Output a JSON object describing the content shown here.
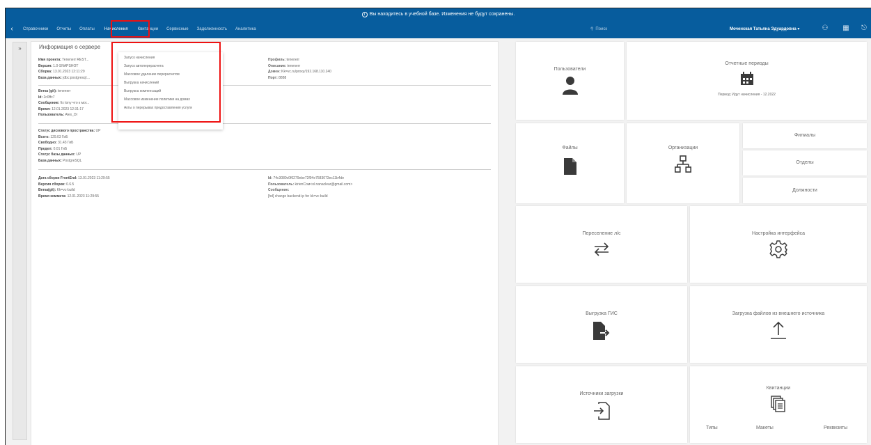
{
  "banner": {
    "text": "Вы находитесь в учебной базе. Изменения не будут сохранены."
  },
  "nav": {
    "items": [
      "Справочники",
      "Отчеты",
      "Оплаты",
      "Начисления",
      "Квитанции",
      "Сервисные",
      "Задолженность",
      "Аналитика"
    ],
    "search_placeholder": "Поиск",
    "user": "Моченская Татьяна Эдуардовна"
  },
  "panel": {
    "title": "Информация о сервере",
    "server": [
      {
        "k": "Имя проекта:",
        "v": "Tenenerr REST..."
      },
      {
        "k": "Версия:",
        "v": "1.0-SNAPSHOT"
      },
      {
        "k": "Сборка:",
        "v": "13.01.2023 12:11:29"
      },
      {
        "k": "База данных:",
        "v": "jdbc:postgresql:..."
      }
    ],
    "profile": [
      {
        "k": "Профиль:",
        "v": "tenenerr"
      },
      {
        "k": "Описание:",
        "v": "tenenerr"
      },
      {
        "k": "Домен:",
        "v": "Kk=vc.ru/proxy/192.168.110.240"
      },
      {
        "k": "Порт:",
        "v": "8888"
      }
    ],
    "git": [
      {
        "k": "Ветка (git):",
        "v": "tenenerr"
      },
      {
        "k": "Id:",
        "v": "2c0ffc7"
      },
      {
        "k": "Сообщение:",
        "v": "fix tony что к мог..."
      },
      {
        "k": "Время:",
        "v": "12.01.2023 12:31:17"
      },
      {
        "k": "Пользователь:",
        "v": "Alex_Dr"
      }
    ],
    "disk": [
      {
        "k": "Статус дискового пространства:",
        "v": "UP"
      },
      {
        "k": "Всего:",
        "v": "129.03 ГиБ"
      },
      {
        "k": "Свободно:",
        "v": "31.43 ГиБ"
      },
      {
        "k": "Предел:",
        "v": "0.01 ГиБ"
      },
      {
        "k": "Статус базы данных:",
        "v": "UP"
      },
      {
        "k": "База данных:",
        "v": "PostgreSQL"
      }
    ],
    "front": [
      {
        "k": "Дата сборки FrontEnd:",
        "v": "13.01.2023 11:29:55"
      },
      {
        "k": "Версия сборки:",
        "v": "0.6.5"
      },
      {
        "k": "Ветка(git):",
        "v": "Kk=vc-build"
      },
      {
        "k": "Время коммита:",
        "v": "12.01.2023 11:29:55"
      }
    ],
    "front2": [
      {
        "k": "Id:",
        "v": "74c3080c0f6279ebe72f94e7583073ec11b4de"
      },
      {
        "k": "Пользователь:",
        "v": "kirienСом<ol.nanaclear@gmail.com>"
      },
      {
        "k": "Сообщение:",
        "v": ""
      },
      {
        "k": "",
        "v": "[hd] change backend-ip for kk=vc build"
      }
    ]
  },
  "dropdown": [
    "Запуск начисления",
    "Запуск автоперерасчета",
    "Массовое удаление перерасчетов",
    "Выгрузка начислений",
    "Выгрузка компенсаций",
    "Массовое изменение политики на домах",
    "Акты о перерывах предоставления услуги"
  ],
  "tiles": {
    "users": "Пользователи",
    "periods": "Отчетные периоды",
    "period_note": "Период: Идут начисления - 12.2022",
    "files": "Файлы",
    "orgs": "Организации",
    "branches": "Филиалы",
    "depts": "Отделы",
    "positions": "Должности",
    "transfer": "Переселение л/с",
    "ui_settings": "Настройка интерфейса",
    "gis": "Выгрузка ГИС",
    "ext_load": "Загрузка файлов из внешнего источника",
    "sources": "Источники загрузки",
    "receipts": "Квитанции",
    "types": "Типы",
    "layouts": "Макеты",
    "details": "Реквизиты"
  }
}
